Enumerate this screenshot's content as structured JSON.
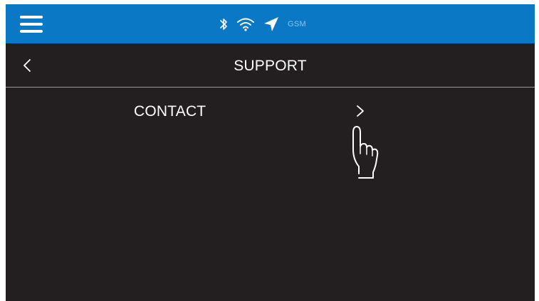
{
  "status_bar": {
    "menu_icon": "hamburger-menu-icon",
    "icons": [
      "bluetooth-icon",
      "wifi-icon",
      "location-arrow-icon"
    ],
    "network_label": "GSM",
    "background_color": "#0a78c4"
  },
  "header": {
    "back_icon": "chevron-left-icon",
    "title": "SUPPORT"
  },
  "menu": {
    "items": [
      {
        "label": "CONTACT",
        "icon": "chevron-right-icon"
      }
    ]
  },
  "overlay": {
    "icon": "pointing-hand-icon"
  },
  "colors": {
    "background": "#231f20",
    "text": "#ffffff",
    "divider": "#9a9a9a",
    "accent": "#0a78c4"
  }
}
